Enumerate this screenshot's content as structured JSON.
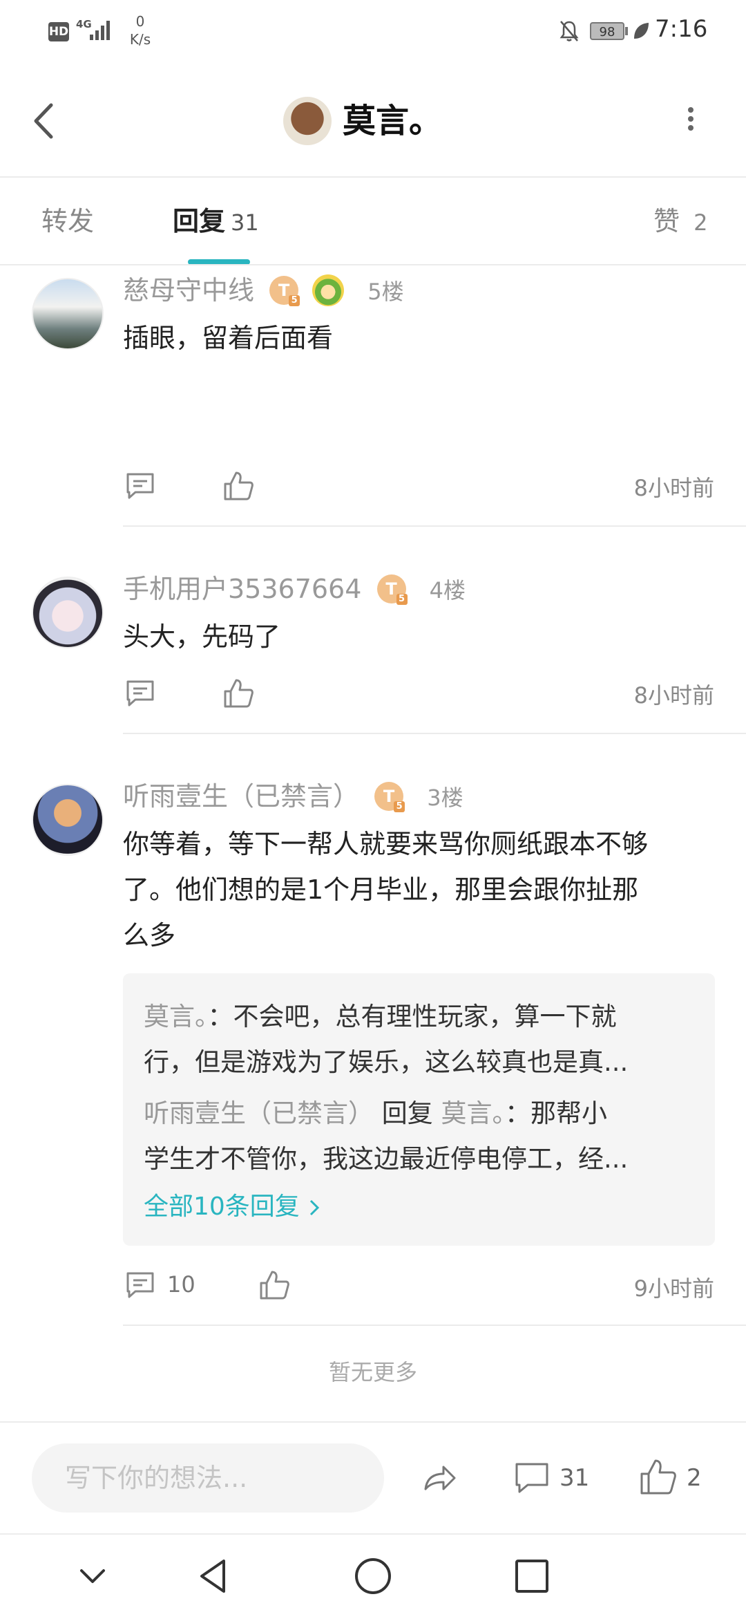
{
  "status_bar": {
    "network_label": "HD",
    "network_type": "4G",
    "speed_value": "0",
    "speed_unit": "K/s",
    "battery": "98",
    "time": "7:16"
  },
  "header": {
    "title": "莫言。"
  },
  "tabs": {
    "forward_label": "转发",
    "reply_label": "回复",
    "reply_count": "31",
    "like_label": "赞",
    "like_count": "2"
  },
  "comments": [
    {
      "username": "慈母守中线",
      "badge": "T",
      "badge_level": "5",
      "floor": "5楼",
      "content": "插眼，留着后面看",
      "reply_count": "",
      "time": "8小时前"
    },
    {
      "username": "手机用户35367664",
      "badge": "T",
      "badge_level": "5",
      "floor": "4楼",
      "content": "头大，先码了",
      "reply_count": "",
      "time": "8小时前"
    },
    {
      "username": "听雨壹生（已禁言）",
      "badge": "T",
      "badge_level": "5",
      "floor": "3楼",
      "content_lines": [
        "你等着，等下一帮人就要来骂你厕纸跟本不够",
        "了。他们想的是1个月毕业，那里会跟你扯那",
        "么多"
      ],
      "reply_count": "10",
      "time": "9小时前",
      "replies": {
        "r1_name": "莫言。",
        "r1_line1": "：不会吧，总有理性玩家，算一下就",
        "r1_line2": "行，但是游戏为了娱乐，这么较真也是真...",
        "r2_name": "听雨壹生（已禁言）",
        "r2_reply_word": "回复",
        "r2_target": "莫言。",
        "r2_line1": "：那帮小",
        "r2_line2": "学生才不管你，我这边最近停电停工，经...",
        "all_label": "全部10条回复"
      }
    }
  ],
  "no_more": "暂无更多",
  "bottom_bar": {
    "input_placeholder": "写下你的想法...",
    "comment_count": "31",
    "like_count": "2"
  },
  "icons": {
    "back": "chevron-left-icon",
    "more": "more-vertical-icon",
    "comment": "comment-icon",
    "like": "thumbs-up-icon",
    "share": "share-icon",
    "nav_hide": "chevron-down-icon",
    "nav_back": "triangle-back-icon",
    "nav_home": "circle-home-icon",
    "nav_recent": "square-recent-icon"
  },
  "colors": {
    "accent": "#29b5c0",
    "badge": "#f2c08a"
  }
}
